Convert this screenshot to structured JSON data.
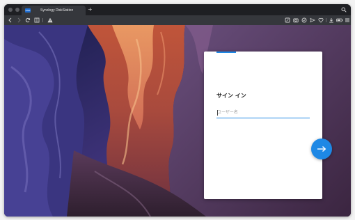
{
  "browser": {
    "tab": {
      "title": "Synology DiskStation",
      "favicon_label": "DSM",
      "favicon_color": "#1f6fd6"
    },
    "new_tab_symbol": "+",
    "toolbar": {
      "left_icons": [
        "back-icon",
        "forward-icon",
        "reload-icon",
        "extensions-icon",
        "warning-icon"
      ],
      "right_icons": [
        "screenshot-icon",
        "camera-icon",
        "wallet-icon",
        "send-icon",
        "heart-icon",
        "download-icon",
        "battery-icon",
        "menu-icon"
      ]
    }
  },
  "login": {
    "title": "サイン イン",
    "username_placeholder": "ユーザー名",
    "username_value": "",
    "accent_color": "#1e88e5",
    "next_icon": "arrow-right-icon"
  }
}
